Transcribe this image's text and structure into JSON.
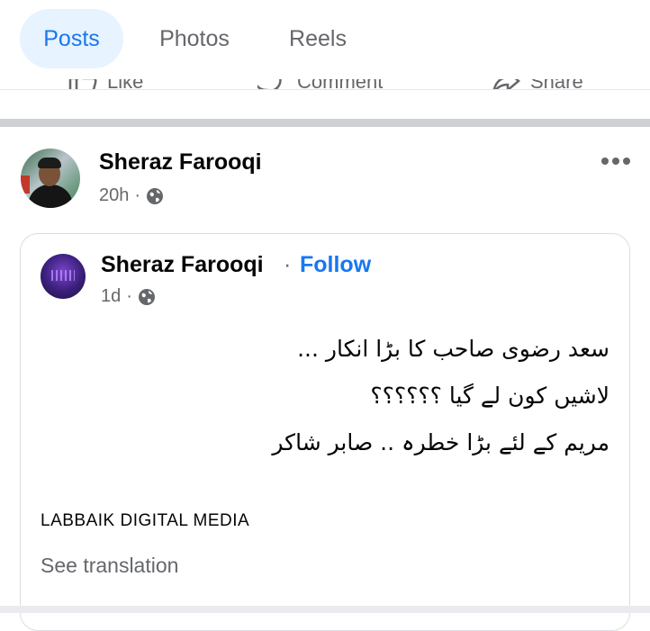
{
  "tabs": [
    {
      "label": "Posts",
      "active": true
    },
    {
      "label": "Photos",
      "active": false
    },
    {
      "label": "Reels",
      "active": false
    }
  ],
  "action_bar": {
    "like_label": "Like",
    "comment_label": "Comment",
    "share_label": "Share"
  },
  "post": {
    "author": "Sheraz Farooqi",
    "time": "20h",
    "separator": "·",
    "audience_icon": "globe-icon",
    "menu_icon": "more-horizontal-icon"
  },
  "shared_post": {
    "author": "Sheraz Farooqi",
    "separator": "·",
    "follow_label": "Follow",
    "time": "1d",
    "audience_icon": "globe-icon",
    "lines": [
      "سعد رضوی صاحب کا بڑا انکار ...",
      "لاشیں کون لے گیا ؟؟؟؟؟؟",
      "مریم کے لئے بڑا خطرہ .. صابر شاکر"
    ],
    "caption": "LABBAIK DIGITAL MEDIA",
    "see_translation": "See translation"
  },
  "colors": {
    "accent": "#1877f2",
    "active_tab_bg": "#e7f3ff",
    "secondary_text": "#65676b",
    "divider": "#ced0d4"
  }
}
